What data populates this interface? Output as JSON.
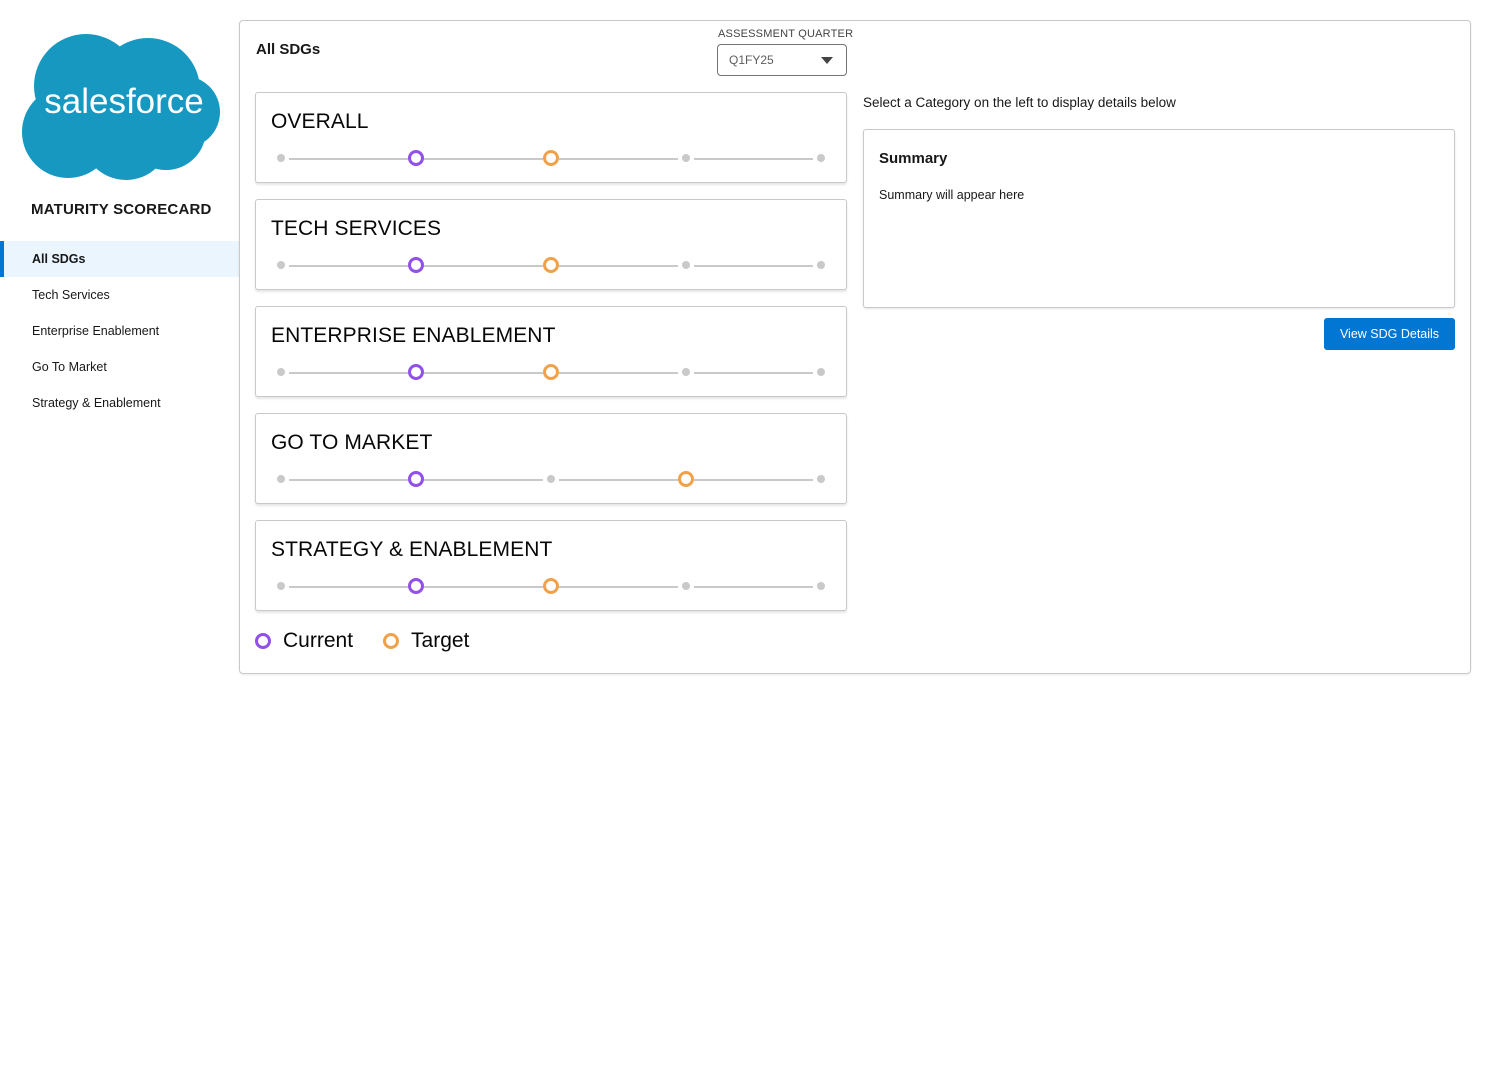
{
  "brand": {
    "logo_text": "salesforce",
    "cloud_color": "#1798c1"
  },
  "sidebar": {
    "title": "MATURITY SCORECARD",
    "items": [
      {
        "label": "All SDGs",
        "active": true
      },
      {
        "label": "Tech Services",
        "active": false
      },
      {
        "label": "Enterprise Enablement",
        "active": false
      },
      {
        "label": "Go To Market",
        "active": false
      },
      {
        "label": "Strategy & Enablement",
        "active": false
      }
    ]
  },
  "main": {
    "title": "All SDGs",
    "quarter": {
      "label": "ASSESSMENT QUARTER",
      "value": "Q1FY25"
    },
    "levels_count": 5,
    "categories": [
      {
        "name": "OVERALL",
        "current": 2,
        "target": 3
      },
      {
        "name": "TECH SERVICES",
        "current": 2,
        "target": 3
      },
      {
        "name": "ENTERPRISE ENABLEMENT",
        "current": 2,
        "target": 3
      },
      {
        "name": "GO TO MARKET",
        "current": 2,
        "target": 4
      },
      {
        "name": "STRATEGY & ENABLEMENT",
        "current": 2,
        "target": 3
      }
    ],
    "legend": {
      "current": "Current",
      "target": "Target"
    },
    "colors": {
      "current": "#9050e9",
      "target": "#f0a24a",
      "inactive": "#c9c9c9",
      "accent": "#0176d3"
    }
  },
  "detail": {
    "hint": "Select a Category on the left to display details below",
    "summary_title": "Summary",
    "summary_text": "Summary will appear here",
    "button_label": "View SDG Details"
  }
}
